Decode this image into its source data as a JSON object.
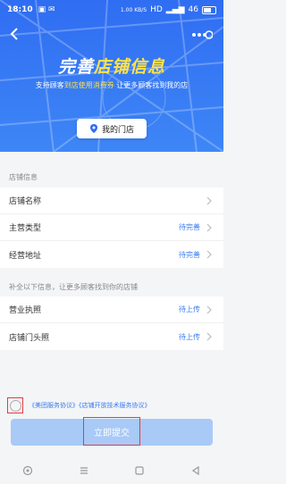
{
  "status_bar": {
    "time": "18:10",
    "network": "1.00 KB/S",
    "hd": "HD",
    "signal": "46",
    "battery": ""
  },
  "banner": {
    "headline_prefix": "完善",
    "headline_highlight": "店铺信息",
    "sub_prefix": "支持顾客",
    "sub_highlight": "到店使用消费券",
    "sub_suffix": " 让更多顾客找到我的店",
    "store_chip": "我的门店"
  },
  "section1": {
    "title": "店铺信息",
    "rows": [
      {
        "label": "店铺名称",
        "value": ""
      },
      {
        "label": "主营类型",
        "value": "待完善"
      },
      {
        "label": "经营地址",
        "value": "待完善"
      }
    ]
  },
  "section2": {
    "title": "补全以下信息，让更多顾客找到你的店铺",
    "rows": [
      {
        "label": "营业执照",
        "value": "待上传"
      },
      {
        "label": "店铺门头照",
        "value": "待上传"
      }
    ]
  },
  "agreement": {
    "text": "《美团服务协议》《店铺开放技术服务协议》"
  },
  "submit": {
    "label": "立即提交"
  },
  "colors": {
    "accent": "#3a7bf0",
    "banner": "#2f6df2",
    "highlight": "#ffe24a",
    "outline": "#e8383d"
  }
}
